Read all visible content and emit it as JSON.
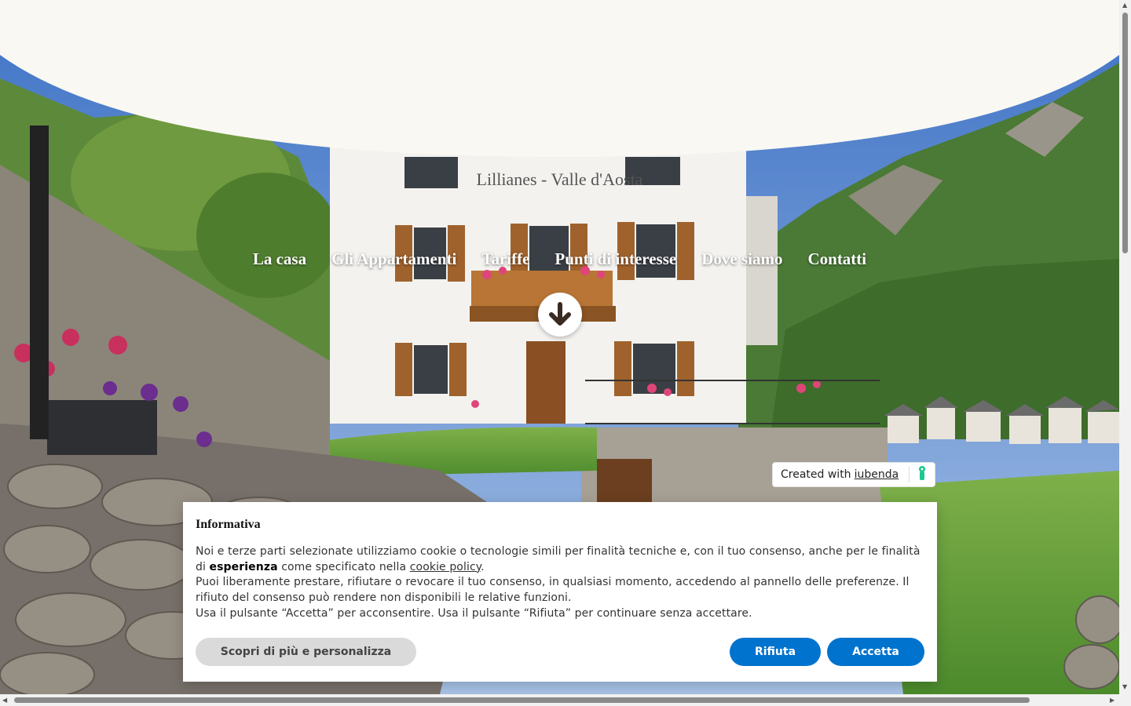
{
  "header": {
    "subtitle": "Lillianes - Valle d'Aosta"
  },
  "nav": {
    "items": [
      {
        "label": "La casa"
      },
      {
        "label": "Gli Appartamenti"
      },
      {
        "label": "Tariffe"
      },
      {
        "label": "Punti di interesse"
      },
      {
        "label": "Dove siamo"
      },
      {
        "label": "Contatti"
      }
    ]
  },
  "scroll_button": {
    "icon": "arrow-down-icon"
  },
  "iubenda_badge": {
    "prefix": "Created with",
    "link": "iubenda",
    "icon": "iubenda-logo-icon",
    "icon_color": "#1cc691"
  },
  "cookie_banner": {
    "title": "Informativa",
    "p1_a": "Noi e terze parti selezionate utilizziamo cookie o tecnologie simili per finalità tecniche e, con il tuo consenso, anche per le finalità di ",
    "p1_bold": "esperienza",
    "p1_b": " come specificato nella ",
    "p1_link": "cookie policy",
    "p1_c": ".",
    "p2": "Puoi liberamente prestare, rifiutare o revocare il tuo consenso, in qualsiasi momento, accedendo al pannello delle preferenze. Il rifiuto del consenso può rendere non disponibili le relative funzioni.",
    "p3": "Usa il pulsante “Accetta” per acconsentire. Usa il pulsante “Rifiuta” per continuare senza accettare.",
    "btn_more": "Scopri di più e personalizza",
    "btn_reject": "Rifiuta",
    "btn_accept": "Accetta"
  },
  "colors": {
    "accent": "#0073ce",
    "header_bg": "#f9f8f3",
    "secondary_button": "#dadada"
  }
}
